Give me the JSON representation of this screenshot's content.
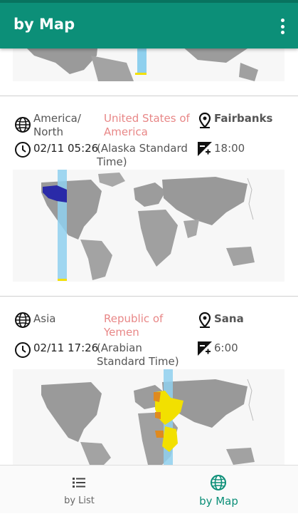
{
  "app": {
    "title": "by Map"
  },
  "cards": [
    {
      "continent": "America/\nNorth",
      "country": "United States of America",
      "city": "Fairbanks",
      "datetime": "02/11 05:26",
      "timezone": "(Alaska Standard Time)",
      "offset": "18:00",
      "highlight_color": "#2a2aa8"
    },
    {
      "continent": "Asia",
      "country": "Republic of Yemen",
      "city": "Sana",
      "datetime": "02/11 17:26",
      "timezone": "(Arabian Standard Time)",
      "offset": "6:00",
      "highlight_color": "#f2e000"
    }
  ],
  "bottom_nav": {
    "tabs": [
      {
        "label": "by List",
        "icon": "list-icon",
        "active": false
      },
      {
        "label": "by Map",
        "icon": "globe-icon",
        "active": true
      }
    ]
  },
  "colors": {
    "primary": "#0c8f78",
    "country_text": "#e88787",
    "band": "#8fd0ee"
  }
}
